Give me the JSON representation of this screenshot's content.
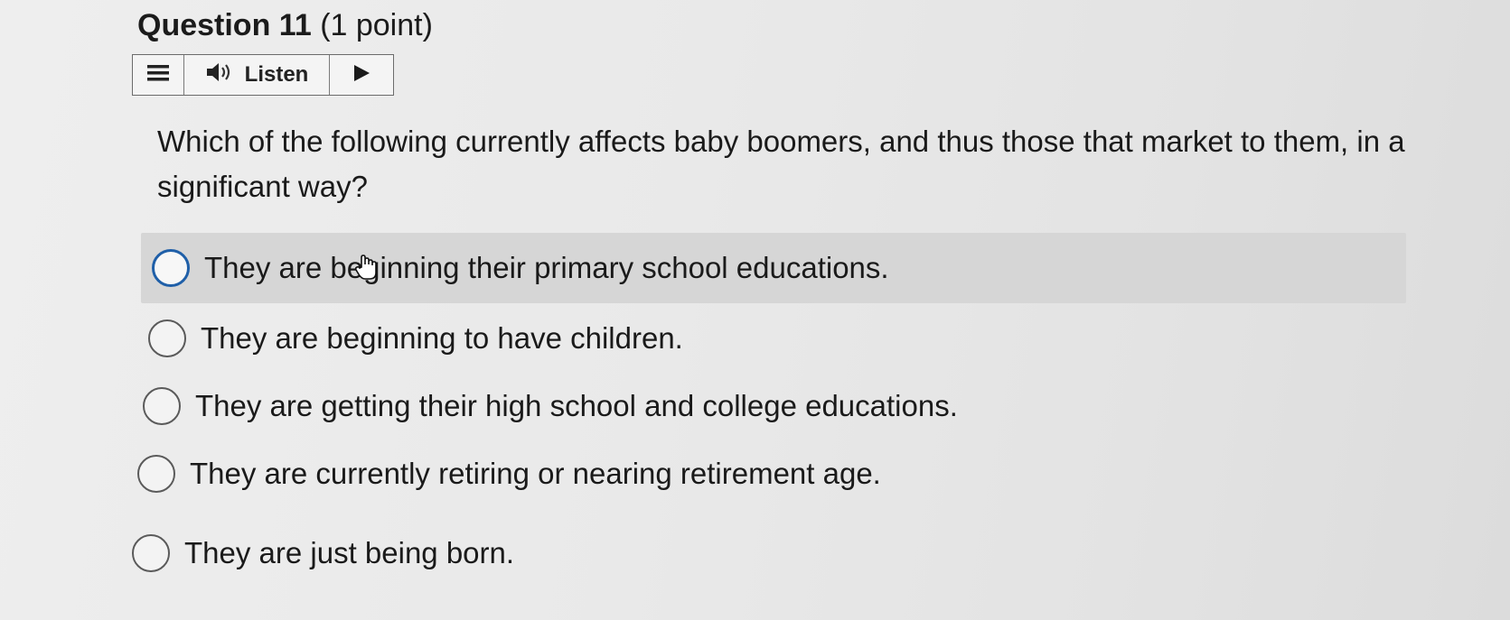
{
  "question": {
    "title": "Question 11",
    "points": "(1 point)",
    "text": "Which of the following currently affects baby boomers, and thus those that market to them, in a significant way?"
  },
  "toolbar": {
    "menu_icon": "menu-icon",
    "speaker_icon": "speaker-icon",
    "listen_label": "Listen",
    "play_icon": "play-icon"
  },
  "options": [
    {
      "label": "They are beginning their primary school educations.",
      "selected": false,
      "hovered": true
    },
    {
      "label": "They are beginning to have children.",
      "selected": false,
      "hovered": false
    },
    {
      "label": "They are getting their high school and college educations.",
      "selected": false,
      "hovered": false
    },
    {
      "label": "They are currently retiring or nearing retirement age.",
      "selected": false,
      "hovered": false
    },
    {
      "label": "They are just being born.",
      "selected": false,
      "hovered": false
    }
  ],
  "colors": {
    "focus_ring": "#1f5fa8",
    "hover_row": "#d6d6d6"
  }
}
